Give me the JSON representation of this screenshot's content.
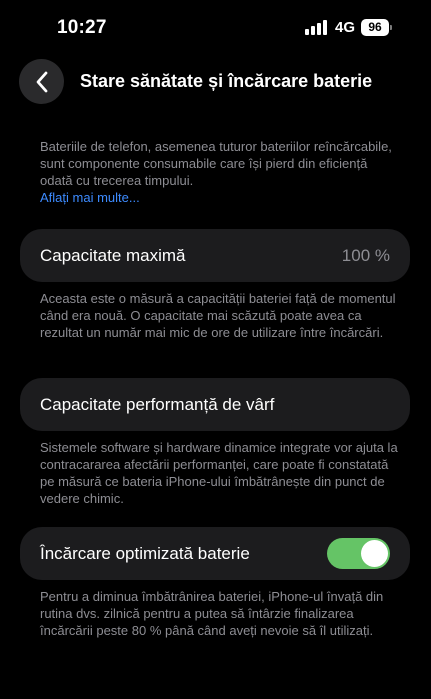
{
  "status_bar": {
    "time": "10:27",
    "network": "4G",
    "battery": "96"
  },
  "header": {
    "title": "Stare sănătate și încărcare baterie"
  },
  "intro": {
    "text": "Bateriile de telefon, asemenea tuturor bateriilor reîncărcabile, sunt componente consumabile care își pierd din eficiență odată cu trecerea timpului.",
    "link": "Aflați mai multe..."
  },
  "max_capacity": {
    "label": "Capacitate maximă",
    "value": "100 %",
    "description": "Aceasta este o măsură a capacității bateriei față de momentul când era nouă. O capacitate mai scăzută poate avea ca rezultat un număr mai mic de ore de utilizare între încărcări."
  },
  "peak_performance": {
    "label": "Capacitate performanță de vârf",
    "description": "Sistemele software și hardware dinamice integrate vor ajuta la contracararea afectării performanței, care poate fi constatată pe măsură ce bateria iPhone-ului îmbătrânește din punct de vedere chimic."
  },
  "optimized_charging": {
    "label": "Încărcare optimizată baterie",
    "enabled": true,
    "description": "Pentru a diminua îmbătrânirea bateriei, iPhone-ul învață din rutina dvs. zilnică pentru a putea să întârzie finalizarea încărcării peste 80 % până când aveți nevoie să îl utilizați."
  },
  "colors": {
    "background": "#000000",
    "cell": "#1c1c1e",
    "secondary_text": "#8d8d93",
    "link": "#3d8bff",
    "toggle_on": "#65c466",
    "toggle_off": "#39393d"
  }
}
